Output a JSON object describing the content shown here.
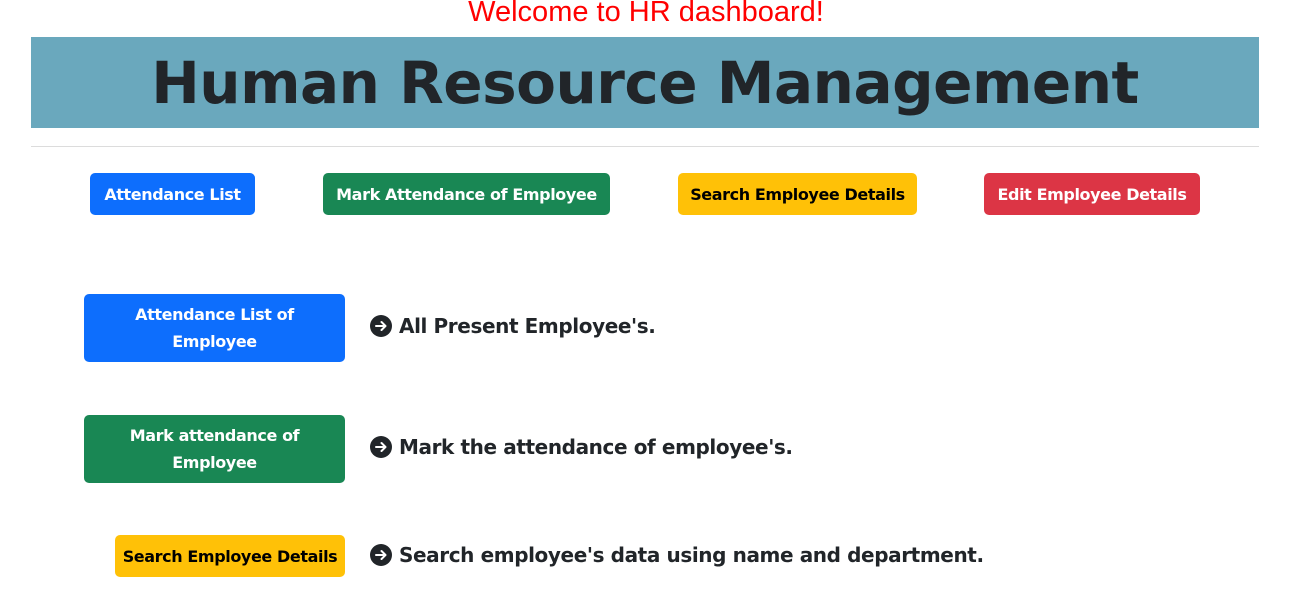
{
  "header": {
    "welcome": "Welcome to HR dashboard!",
    "title": "Human Resource Management"
  },
  "nav": {
    "attendance_list": "Attendance List",
    "mark_attendance": "Mark Attendance of Employee",
    "search_employee": "Search Employee Details",
    "edit_employee": "Edit Employee Details"
  },
  "features": [
    {
      "button": "Attendance List of Employee",
      "description": "All Present Employee's.",
      "icon": "arrow-right-circle-icon"
    },
    {
      "button": "Mark attendance of Employee",
      "description": "Mark the attendance of employee's.",
      "icon": "arrow-right-circle-icon"
    },
    {
      "button": "Search Employee Details",
      "description": "Search employee's data using name and department.",
      "icon": "arrow-right-circle-icon"
    }
  ],
  "colors": {
    "welcome": "#ff0000",
    "banner": "#6aa8bd",
    "primary": "#0d6efd",
    "success": "#198754",
    "warning": "#ffc107",
    "danger": "#dc3545"
  }
}
